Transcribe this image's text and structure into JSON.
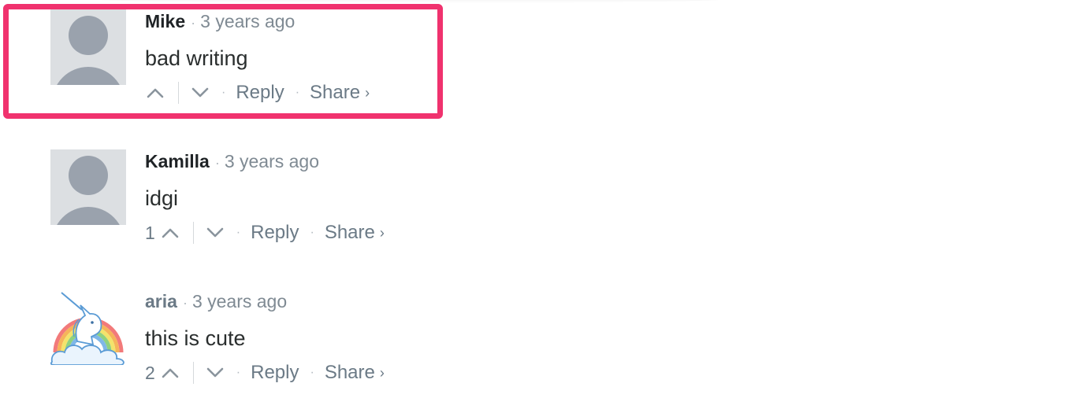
{
  "comments": [
    {
      "author": "Mike",
      "time": "3 years ago",
      "message": "bad writing",
      "votes": "",
      "reply_label": "Reply",
      "share_label": "Share",
      "avatar": "default-avatar-icon"
    },
    {
      "author": "Kamilla",
      "time": "3 years ago",
      "message": "idgi",
      "votes": "1",
      "reply_label": "Reply",
      "share_label": "Share",
      "avatar": "default-avatar-icon"
    },
    {
      "author": "aria",
      "time": "3 years ago",
      "message": "this is cute",
      "votes": "2",
      "reply_label": "Reply",
      "share_label": "Share",
      "avatar": "unicorn-avatar-icon"
    }
  ],
  "separators": {
    "dot": "·",
    "share_arrow": "›"
  },
  "colors": {
    "highlight": "#f0326e",
    "avatar_bg": "#dcdfe2",
    "avatar_fg": "#9aa2ad",
    "muted_text": "#6b7a86"
  }
}
